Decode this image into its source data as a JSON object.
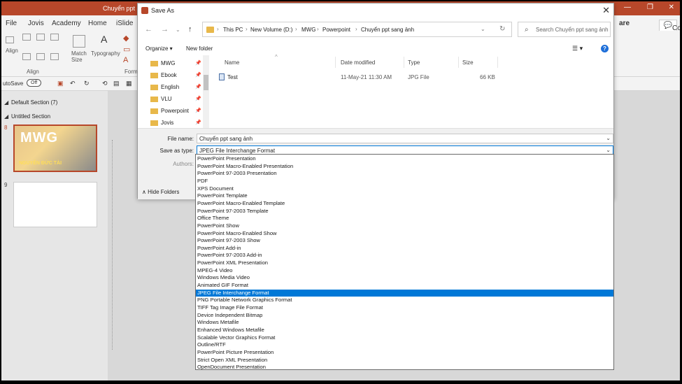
{
  "app": {
    "window_title": "Chuyển ppt s...",
    "share_label": "are",
    "comments_label": "Comments",
    "tabs": [
      "File",
      "Jovis",
      "Academy",
      "Home",
      "iSlide"
    ],
    "ribbon": {
      "match_size": "Match Size",
      "typography": "Typography",
      "align_group": "Align",
      "format_group": "Form",
      "align_btn": "Align",
      "autosave": "utoSave",
      "autosave_state": "Off"
    },
    "slides": {
      "default_section": "Default Section (7)",
      "untitled_section": "Untitled Section",
      "slide_num_1": "8",
      "slide_num_2": "9",
      "thumb_heading": "MWG",
      "thumb_name": "NGUYỄN ĐỨC TÀI"
    }
  },
  "dialog": {
    "title": "Save As",
    "path": [
      "This PC",
      "New Volume (D:)",
      "MWG",
      "Powerpoint",
      "Chuyển ppt sang ảnh"
    ],
    "search_placeholder": "Search Chuyển ppt sang ảnh",
    "organize": "Organize ▾",
    "new_folder": "New folder",
    "nav_items": [
      "MWG",
      "Ebook",
      "English",
      "VLU",
      "Powerpoint",
      "Jovis"
    ],
    "columns": {
      "name": "Name",
      "date": "Date modified",
      "type": "Type",
      "size": "Size"
    },
    "files": [
      {
        "name": "Test",
        "date": "11-May-21 11:30 AM",
        "type": "JPG File",
        "size": "66 KB"
      }
    ],
    "file_name_label": "File name:",
    "file_name_value": "Chuyển ppt sang ảnh",
    "save_type_label": "Save as type:",
    "save_type_value": "JPEG File Interchange Format",
    "authors_label": "Authors:",
    "hide_folders": "Hide Folders"
  },
  "save_types": [
    "PowerPoint Presentation",
    "PowerPoint Macro-Enabled Presentation",
    "PowerPoint 97-2003 Presentation",
    "PDF",
    "XPS Document",
    "PowerPoint Template",
    "PowerPoint Macro-Enabled Template",
    "PowerPoint 97-2003 Template",
    "Office Theme",
    "PowerPoint Show",
    "PowerPoint Macro-Enabled Show",
    "PowerPoint 97-2003 Show",
    "PowerPoint Add-in",
    "PowerPoint 97-2003 Add-in",
    "PowerPoint XML Presentation",
    "MPEG-4 Video",
    "Windows Media Video",
    "Animated GIF Format",
    "JPEG File Interchange Format",
    "PNG Portable Network Graphics Format",
    "TIFF Tag Image File Format",
    "Device Independent Bitmap",
    "Windows Metafile",
    "Enhanced Windows Metafile",
    "Scalable Vector Graphics Format",
    "Outline/RTF",
    "PowerPoint Picture Presentation",
    "Strict Open XML Presentation",
    "OpenDocument Presentation"
  ],
  "selected_save_type_index": 18,
  "colors": {
    "accent": "#b7472a",
    "selection": "#0078d7"
  }
}
